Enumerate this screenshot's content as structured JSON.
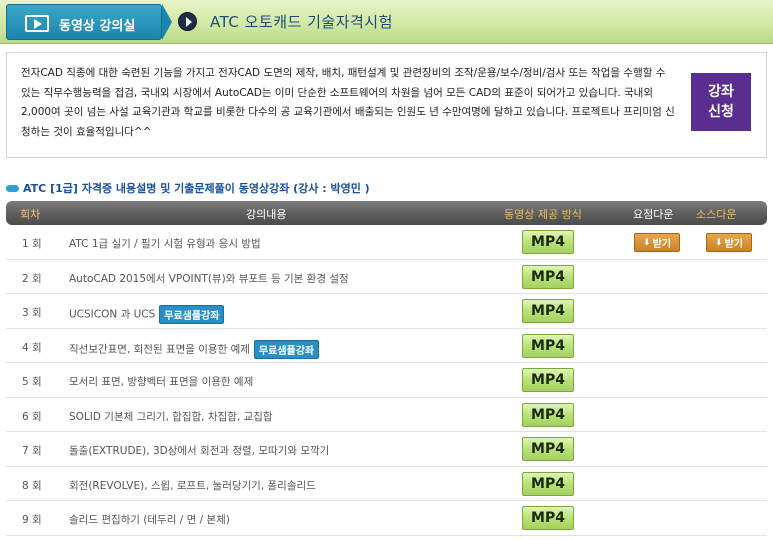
{
  "header": {
    "tab_label": "동영상 강의실",
    "title": "ATC 오토캐드 기술자격시험"
  },
  "intro": {
    "text": "전자CAD 직종에 대한 숙련된 기능을 가지고 전자CAD 도면의 제작, 배치, 패턴설계 및 관련장비의 조작/운용/보수/정비/검사 또는 작업을 수행할 수 있는 직무수행능력을 접검, 국내외 시장에서 AutoCAD는 이미 단순한 소프트웨어의 차원을 넘어 모든 CAD의 표준이 되어가고 있습니다. 국내외 2,000여 곳이 넘는 사설 교육기관과 학교를 비롯한 다수의 공 교육기관에서 배출되는 인원도 년 수만여명에 달하고 있습니다. 프로젝트나 프리미엄 신청하는 것이 효율적입니다^^",
    "apply_label": "강좌\n신청"
  },
  "course": {
    "title": "ATC [1급] 자격증 내용설명 및 기출문제풀이 동영상강좌 (강사 : 박영민 )"
  },
  "table": {
    "headers": {
      "num": "회차",
      "content": "강의내용",
      "method": "동영상 제공 방식",
      "summary": "요점다운",
      "source": "소스다운"
    },
    "mp4_label": "MP4",
    "download_label": "받기",
    "rows": [
      {
        "num": "1 회",
        "title": "ATC 1급 실기 / 필기 시험 유형과 응시 방법",
        "badge": "",
        "downloads": true
      },
      {
        "num": "2 회",
        "title": "AutoCAD 2015에서 VPOINT(뷰)와 뷰포트 등 기본 환경 설정",
        "badge": "",
        "downloads": false
      },
      {
        "num": "3 회",
        "title": "UCSICON 과 UCS",
        "badge": "무료샘플강좌",
        "downloads": false
      },
      {
        "num": "4 회",
        "title": "직선보간표면, 회전된 표면을 이용한 예제",
        "badge": "무료샘플강좌",
        "downloads": false
      },
      {
        "num": "5 회",
        "title": "모서리 표면, 방향벡터 표면을 이용한 예제",
        "badge": "",
        "downloads": false
      },
      {
        "num": "6 회",
        "title": "SOLID 기본체 그리기, 합집합, 차집합, 교집합",
        "badge": "",
        "downloads": false
      },
      {
        "num": "7 회",
        "title": "돌출(EXTRUDE), 3D상에서 회전과 정렬, 모따기와 모깍기",
        "badge": "",
        "downloads": false
      },
      {
        "num": "8 회",
        "title": "회전(REVOLVE), 스윕, 로프트, 눌러당기기, 폴리솔리드",
        "badge": "",
        "downloads": false
      },
      {
        "num": "9 회",
        "title": "솔리드 편집하기 (테두리 / 면 / 본체)",
        "badge": "",
        "downloads": false
      }
    ]
  }
}
